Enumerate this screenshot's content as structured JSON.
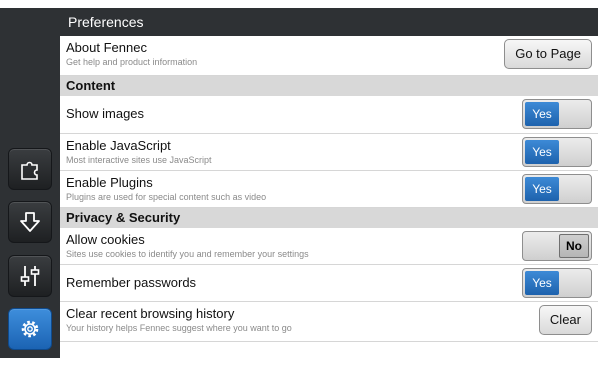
{
  "header": {
    "title": "Preferences"
  },
  "sidebar": {
    "items": [
      {
        "icon": "puzzle-icon",
        "active": false
      },
      {
        "icon": "download-icon",
        "active": false
      },
      {
        "icon": "sliders-icon",
        "active": false
      },
      {
        "icon": "gear-icon",
        "active": true
      }
    ]
  },
  "rows": {
    "about": {
      "title": "About Fennec",
      "desc": "Get help and product information",
      "button": "Go to Page"
    },
    "content_header": "Content",
    "show_images": {
      "title": "Show images",
      "toggle": "Yes"
    },
    "javascript": {
      "title": "Enable JavaScript",
      "desc": "Most interactive sites use JavaScript",
      "toggle": "Yes"
    },
    "plugins": {
      "title": "Enable Plugins",
      "desc": "Plugins are used for special content such as video",
      "toggle": "Yes"
    },
    "privacy_header": "Privacy & Security",
    "cookies": {
      "title": "Allow cookies",
      "desc": "Sites use cookies to identify you and remember your settings",
      "toggle": "No"
    },
    "passwords": {
      "title": "Remember passwords",
      "toggle": "Yes"
    },
    "history": {
      "title": "Clear recent browsing history",
      "desc": "Your history helps Fennec suggest where you want to go",
      "button": "Clear"
    }
  },
  "colors": {
    "accent": "#2b74c4",
    "dark": "#2e3134",
    "section": "#d8d8d8"
  }
}
